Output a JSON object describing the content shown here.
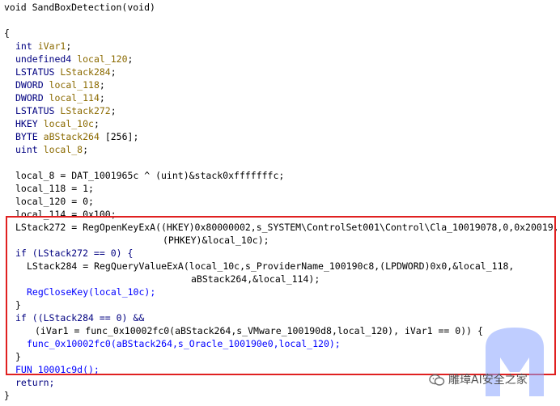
{
  "function_signature": "void SandBoxDetection(void)",
  "open_brace": "{",
  "declarations": {
    "ivar1_type": "int",
    "ivar1_name": "iVar1",
    "local120_type": "undefined4",
    "local120_name": "local_120",
    "lstack284_type": "LSTATUS",
    "lstack284_name": "LStack284",
    "local118_type": "DWORD",
    "local118_name": "local_118",
    "local114_type": "DWORD",
    "local114_name": "local_114",
    "lstack272_type": "LSTATUS",
    "lstack272_name": "LStack272",
    "local10c_type": "HKEY",
    "local10c_name": "local_10c",
    "abstack264_type": "BYTE",
    "abstack264_name": "aBStack264",
    "abstack264_size": "[256]",
    "local8_type": "uint",
    "local8_name": "local_8"
  },
  "assignments": {
    "local_8": "local_8 = DAT_1001965c ^ (uint)&stack0xfffffffc;",
    "local_118": "local_118 = 1;",
    "local_120": "local_120 = 0;",
    "local_114": "local_114 = 0x100;"
  },
  "highlighted_block": {
    "reg_open_line1": "LStack272 = RegOpenKeyExA((HKEY)0x80000002,s_SYSTEM\\ControlSet001\\Control\\Cla_10019078,0,0x20019,",
    "reg_open_line2": "(PHKEY)&local_10c);",
    "if_open": "if (LStack272 == 0) {",
    "reg_query_line1": "LStack284 = RegQueryValueExA(local_10c,s_ProviderName_100190c8,(LPDWORD)0x0,&local_118,",
    "reg_query_line2": "aBStack264,&local_114);",
    "reg_close": "RegCloseKey(local_10c);",
    "close_brace1": "}",
    "if_check_line1": "if ((LStack284 == 0) &&",
    "if_check_line2": "(iVar1 = func_0x10002fc0(aBStack264,s_VMware_100190d8,local_120), iVar1 == 0)) {",
    "oracle_call": "func_0x10002fc0(aBStack264,s_Oracle_100190e0,local_120);",
    "close_brace2": "}",
    "fun_call": "FUN_10001c9d();"
  },
  "return_stmt": "return;",
  "close_brace": "}",
  "watermark": {
    "caption": "雕璋AI安全之家",
    "icon": "wechat-icon",
    "logo": "malwarebytes-logo",
    "logo_color": "#8aa4ff"
  },
  "colors": {
    "keyword": "#000080",
    "function": "#0000ff",
    "variable": "#8b6a00",
    "literal": "#006400",
    "highlight_border": "#e02020"
  }
}
